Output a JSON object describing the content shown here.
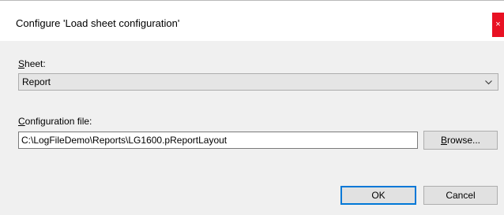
{
  "window": {
    "title": "Configure 'Load sheet configuration'",
    "close_glyph": "×"
  },
  "sheet": {
    "label_mnemonic": "S",
    "label_rest": "heet:",
    "selected_value": "Report",
    "arrow_icon": "chevron-down-icon"
  },
  "config_file": {
    "label_mnemonic": "C",
    "label_rest": "onfiguration file:",
    "value": "C:\\LogFileDemo\\Reports\\LG1600.pReportLayout"
  },
  "buttons": {
    "browse_mnemonic": "B",
    "browse_rest": "rowse...",
    "ok_label": "OK",
    "cancel_label": "Cancel"
  },
  "colors": {
    "close_button": "#e81123",
    "default_button_border": "#0078d7",
    "dialog_background": "#f0f0f0"
  }
}
